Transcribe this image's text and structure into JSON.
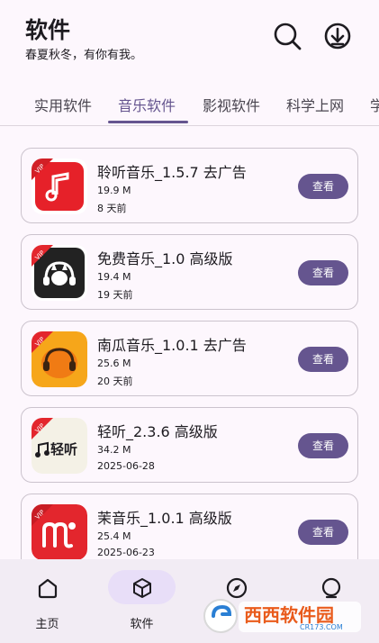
{
  "header": {
    "title": "软件",
    "subtitle": "春夏秋冬，有你有我。",
    "search_icon": "search-icon",
    "download_icon": "download-icon"
  },
  "tabs": [
    {
      "label": "实用软件",
      "active": false
    },
    {
      "label": "音乐软件",
      "active": true
    },
    {
      "label": "影视软件",
      "active": false
    },
    {
      "label": "科学上网",
      "active": false
    },
    {
      "label": "学",
      "active": false
    }
  ],
  "apps": [
    {
      "name": "聆听音乐_1.5.7 去广告",
      "size": "19.9 M",
      "date": "8 天前",
      "button": "查看",
      "badge": "VIP"
    },
    {
      "name": "免费音乐_1.0 高级版",
      "size": "19.4 M",
      "date": "19 天前",
      "button": "查看",
      "badge": "VIP"
    },
    {
      "name": "南瓜音乐_1.0.1 去广告",
      "size": "25.6 M",
      "date": "20 天前",
      "button": "查看",
      "badge": "VIP"
    },
    {
      "name": "轻听_2.3.6 高级版",
      "size": "34.2 M",
      "date": "2025-06-28",
      "button": "查看",
      "badge": "VIP",
      "icon_text": "轻听"
    },
    {
      "name": "茉音乐_1.0.1 高级版",
      "size": "25.4 M",
      "date": "2025-06-23",
      "button": "查看",
      "badge": "VIP"
    }
  ],
  "bottom_nav": [
    {
      "label": "主页",
      "icon": "home-icon",
      "active": false
    },
    {
      "label": "软件",
      "icon": "cube-icon",
      "active": true
    },
    {
      "label": "",
      "icon": "compass-icon",
      "active": false
    },
    {
      "label": "",
      "icon": "profile-icon",
      "active": false
    }
  ],
  "watermark": {
    "text": "西西软件园",
    "sub": "CR173.COM"
  },
  "colors": {
    "accent": "#65558f",
    "background": "#fdf7fd",
    "nav_bg": "#f2ecf4",
    "vip_red": "#e3262d"
  }
}
